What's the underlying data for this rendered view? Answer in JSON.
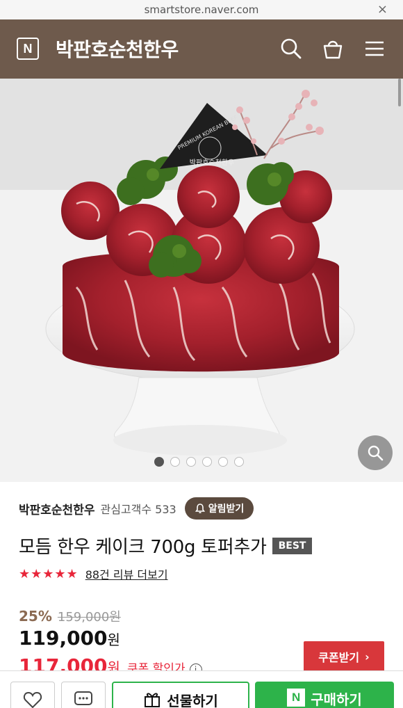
{
  "browser": {
    "url": "smartstore.naver.com",
    "close_icon": "×"
  },
  "header": {
    "logo_letter": "N",
    "store_title": "박판호순천한우"
  },
  "hero": {
    "topper_text": "PREMIUM KOREAN BEEF",
    "topper_brand": "박판호순천한우",
    "carousel": {
      "total": 6,
      "active": 1
    }
  },
  "product": {
    "store_name": "박판호순천한우",
    "interest_label": "관심고객수 533",
    "alarm_button": "알림받기",
    "title": "모듬 한우 케이크 700g 토퍼추가",
    "badge": "BEST",
    "stars": "★★★★★",
    "review_link": "88건 리뷰 더보기",
    "discount": "25%",
    "original_price": "159,000원",
    "price": "119,000",
    "price_unit": "원",
    "coupon_price": "117,000",
    "coupon_unit": "원",
    "coupon_label": "쿠폰 할인가",
    "info_icon": "i",
    "coupon_button": "쿠폰받기",
    "coupon_chevron": "›"
  },
  "bottom_bar": {
    "gift_label": "선물하기",
    "buy_label": "구매하기",
    "buy_logo": "N"
  },
  "colors": {
    "header_bg": "#6e5a4c",
    "accent_red": "#e8263a",
    "coupon_btn": "#d8373b",
    "naver_green": "#2db34a"
  }
}
